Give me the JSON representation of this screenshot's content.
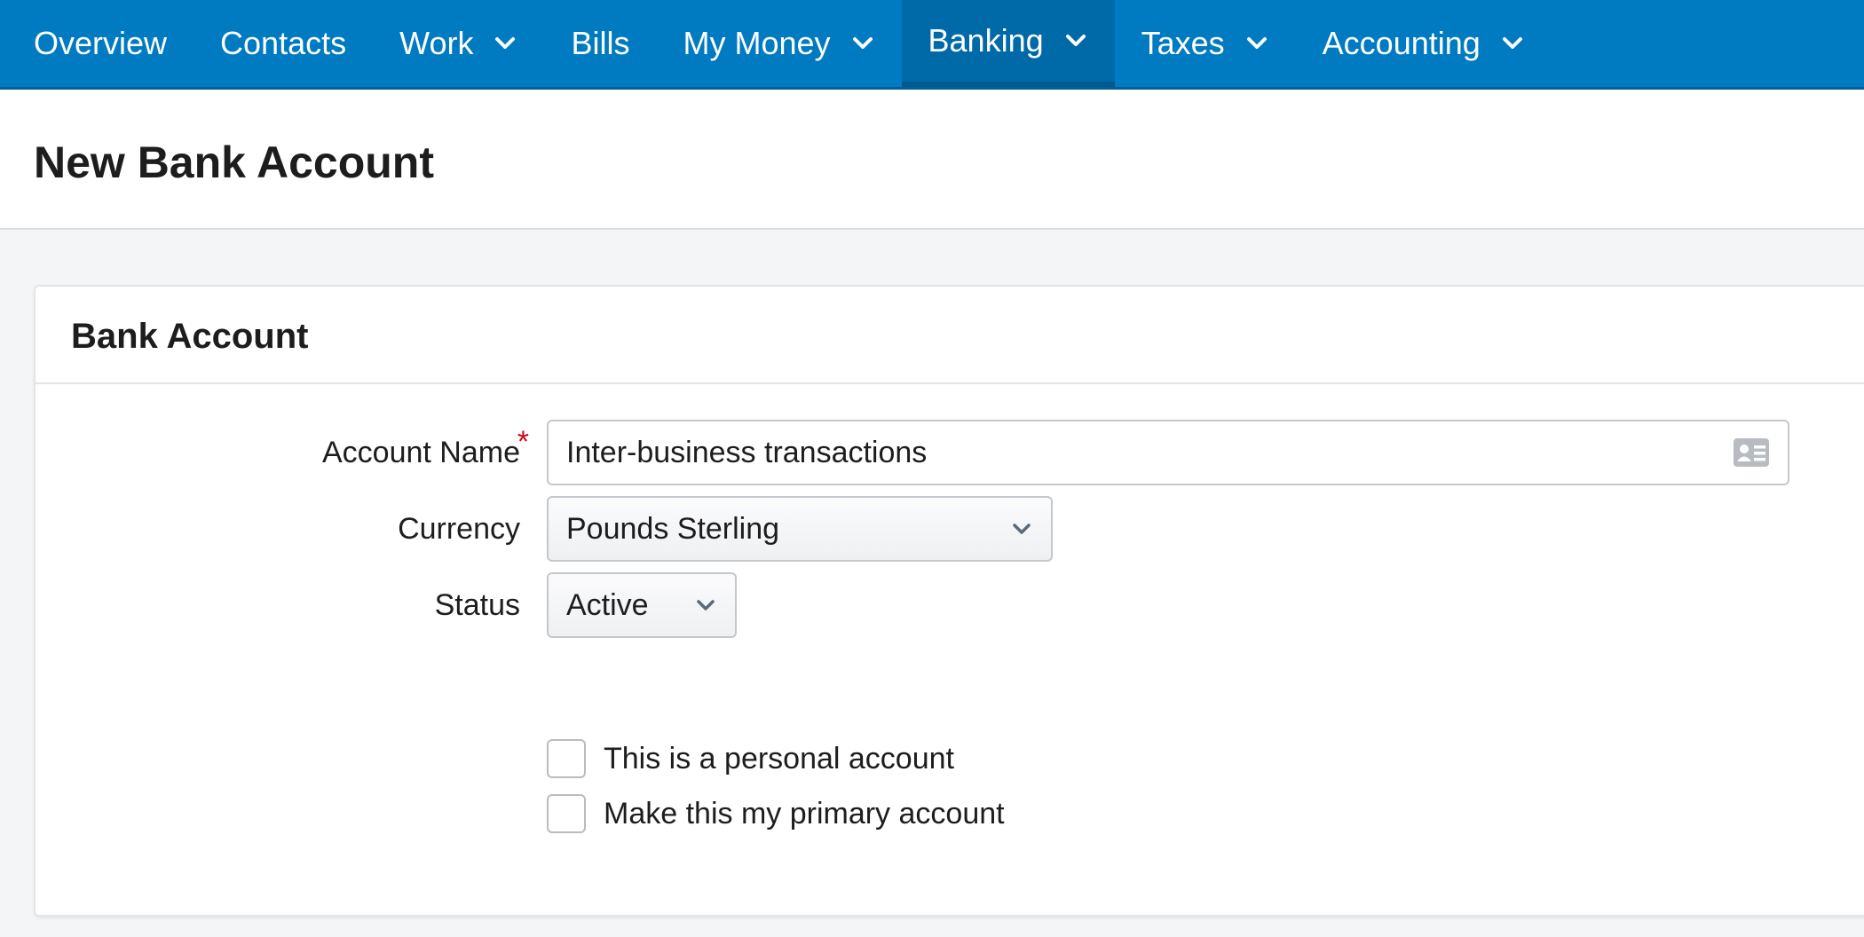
{
  "nav": {
    "items": [
      {
        "label": "Overview",
        "has_dropdown": false
      },
      {
        "label": "Contacts",
        "has_dropdown": false
      },
      {
        "label": "Work",
        "has_dropdown": true
      },
      {
        "label": "Bills",
        "has_dropdown": false
      },
      {
        "label": "My Money",
        "has_dropdown": true
      },
      {
        "label": "Banking",
        "has_dropdown": true,
        "active": true
      },
      {
        "label": "Taxes",
        "has_dropdown": true
      },
      {
        "label": "Accounting",
        "has_dropdown": true
      }
    ]
  },
  "page": {
    "title": "New Bank Account"
  },
  "panel": {
    "title": "Bank Account",
    "account_name": {
      "label": "Account Name",
      "required_marker": "*",
      "value": "Inter-business transactions",
      "icon": "contact-card-icon"
    },
    "currency": {
      "label": "Currency",
      "value": "Pounds Sterling"
    },
    "status": {
      "label": "Status",
      "value": "Active"
    },
    "checkboxes": [
      {
        "label": "This is a personal account",
        "checked": false
      },
      {
        "label": "Make this my primary account",
        "checked": false
      }
    ]
  },
  "colors": {
    "nav_bg": "#007ac0",
    "nav_active": "#006aa8",
    "required": "#d0021b"
  }
}
